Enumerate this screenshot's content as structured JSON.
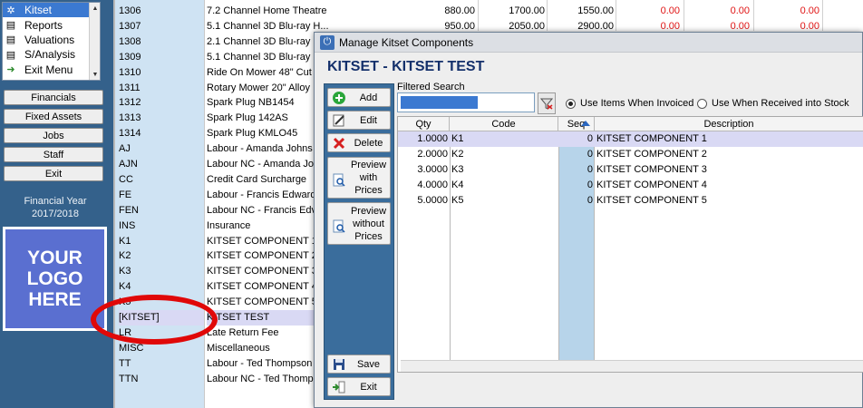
{
  "nav": {
    "items": [
      {
        "label": "Kitset",
        "icon": "gear-icon",
        "selected": true
      },
      {
        "label": "Reports",
        "icon": "document-icon",
        "selected": false
      },
      {
        "label": "Valuations",
        "icon": "document-icon",
        "selected": false
      },
      {
        "label": "S/Analysis",
        "icon": "document-icon",
        "selected": false
      },
      {
        "label": "Exit Menu",
        "icon": "exit-icon",
        "selected": false
      }
    ],
    "buttons": [
      "Financials",
      "Fixed Assets",
      "Jobs",
      "Staff",
      "Exit"
    ],
    "financial_year_label": "Financial Year",
    "financial_year_value": "2017/2018",
    "logo_text": "YOUR\nLOGO\nHERE"
  },
  "background_list": {
    "rows": [
      {
        "code": "1306",
        "desc": "7.2 Channel Home Theatre"
      },
      {
        "code": "1307",
        "desc": "5.1 Channel 3D Blu-ray H..."
      },
      {
        "code": "1308",
        "desc": "2.1 Channel 3D Blu-ray"
      },
      {
        "code": "1309",
        "desc": "5.1 Channel 3D Blu-ray"
      },
      {
        "code": "1310",
        "desc": "Ride On Mower 48\" Cut"
      },
      {
        "code": "1311",
        "desc": "Rotary Mower 20\" Alloy"
      },
      {
        "code": "1312",
        "desc": "Spark Plug NB1454"
      },
      {
        "code": "1313",
        "desc": "Spark Plug 142AS"
      },
      {
        "code": "1314",
        "desc": "Spark Plug KMLO45"
      },
      {
        "code": "AJ",
        "desc": "Labour - Amanda Johns"
      },
      {
        "code": "AJN",
        "desc": "Labour NC - Amanda Jol"
      },
      {
        "code": "CC",
        "desc": "Credit Card Surcharge"
      },
      {
        "code": "FE",
        "desc": "Labour - Francis Edward"
      },
      {
        "code": "FEN",
        "desc": "Labour NC - Francis Edv"
      },
      {
        "code": "INS",
        "desc": "Insurance"
      },
      {
        "code": "K1",
        "desc": "KITSET COMPONENT 1"
      },
      {
        "code": "K2",
        "desc": "KITSET COMPONENT 2"
      },
      {
        "code": "K3",
        "desc": "KITSET COMPONENT 3"
      },
      {
        "code": "K4",
        "desc": "KITSET COMPONENT 4"
      },
      {
        "code": "K5",
        "desc": "KITSET COMPONENT 5"
      },
      {
        "code": "[KITSET]",
        "desc": "KITSET TEST"
      },
      {
        "code": "LR",
        "desc": "Late Return Fee"
      },
      {
        "code": "MISC",
        "desc": "Miscellaneous"
      },
      {
        "code": "TT",
        "desc": "Labour - Ted Thompson"
      },
      {
        "code": "TTN",
        "desc": "Labour NC - Ted Thomps"
      }
    ],
    "highlight_index": 20,
    "top_values": [
      [
        "880.00",
        "1700.00",
        "1550.00",
        "0.00",
        "0.00",
        "0.00"
      ],
      [
        "950.00",
        "2050.00",
        "2900.00",
        "0.00",
        "0.00",
        "0.00"
      ]
    ],
    "negative_color": "#e01515"
  },
  "dialog": {
    "title": "Manage Kitset Components",
    "heading": "KITSET - KITSET TEST",
    "toolbar": [
      {
        "label": "Add",
        "icon": "add-icon"
      },
      {
        "label": "Edit",
        "icon": "edit-icon"
      },
      {
        "label": "Delete",
        "icon": "delete-icon"
      },
      {
        "label": "Preview with Prices",
        "icon": "preview-icon"
      },
      {
        "label": "Preview without Prices",
        "icon": "preview-icon"
      },
      {
        "label": "Save",
        "icon": "save-icon"
      },
      {
        "label": "Exit",
        "icon": "exit-icon"
      }
    ],
    "filter_label": "Filtered Search",
    "filter_value": "",
    "radio_invoiced": "Use Items When Invoiced",
    "radio_received": "Use When Received into Stock",
    "radio_selected": "invoiced",
    "grid": {
      "headers": {
        "qty": "Qty",
        "code": "Code",
        "seq": "Seq",
        "desc": "Description"
      },
      "rows": [
        {
          "qty": "1.0000",
          "code": "K1",
          "seq": "0",
          "desc": "KITSET COMPONENT 1"
        },
        {
          "qty": "2.0000",
          "code": "K2",
          "seq": "0",
          "desc": "KITSET COMPONENT 2"
        },
        {
          "qty": "3.0000",
          "code": "K3",
          "seq": "0",
          "desc": "KITSET COMPONENT 3"
        },
        {
          "qty": "4.0000",
          "code": "K4",
          "seq": "0",
          "desc": "KITSET COMPONENT 4"
        },
        {
          "qty": "5.0000",
          "code": "K5",
          "seq": "0",
          "desc": "KITSET COMPONENT 5"
        }
      ],
      "selected_index": 0
    }
  },
  "colors": {
    "panel": "#34618b",
    "selection": "#3b79d1",
    "row_highlight": "#d9d9f4",
    "annotation": "#e00808",
    "heading": "#14306b"
  }
}
